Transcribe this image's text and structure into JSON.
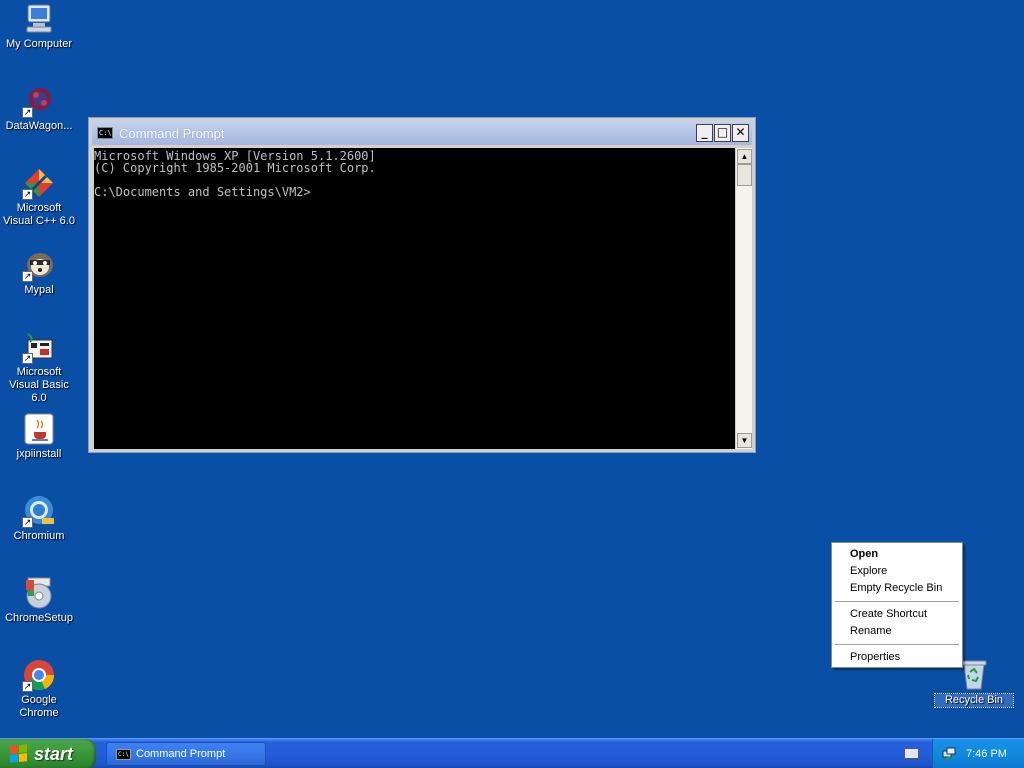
{
  "desktop": {
    "icons": [
      {
        "label": "My Computer",
        "icon": "my-computer-icon"
      },
      {
        "label": "DataWagon...",
        "icon": "datawagon-icon"
      },
      {
        "label": "Microsoft Visual C++ 6.0",
        "icon": "visual-cpp-icon"
      },
      {
        "label": "Mypal",
        "icon": "mypal-icon"
      },
      {
        "label": "Microsoft Visual Basic 6.0",
        "icon": "visual-basic-icon"
      },
      {
        "label": "jxpiinstall",
        "icon": "java-icon"
      },
      {
        "label": "Chromium",
        "icon": "chromium-icon"
      },
      {
        "label": "ChromeSetup",
        "icon": "chrome-setup-icon"
      },
      {
        "label": "Google Chrome",
        "icon": "google-chrome-icon"
      }
    ],
    "recycle_bin": {
      "label": "Recycle Bin",
      "icon": "recycle-bin-icon"
    }
  },
  "cmd_window": {
    "title": "Command Prompt",
    "icon": "C:\\",
    "minimize": "_",
    "maximize": "□",
    "close": "✕",
    "lines": [
      "Microsoft Windows XP [Version 5.1.2600]",
      "(C) Copyright 1985-2001 Microsoft Corp.",
      "",
      "C:\\Documents and Settings\\VM2>"
    ]
  },
  "context_menu": {
    "items": [
      {
        "label": "Open",
        "bold": true
      },
      {
        "label": "Explore"
      },
      {
        "label": "Empty Recycle Bin"
      },
      {
        "separator": true
      },
      {
        "label": "Create Shortcut"
      },
      {
        "label": "Rename"
      },
      {
        "separator": true
      },
      {
        "label": "Properties"
      }
    ]
  },
  "taskbar": {
    "start_label": "start",
    "tasks": [
      {
        "label": "Command Prompt",
        "icon": "C:\\"
      }
    ],
    "clock": "7:46 PM"
  },
  "colors": {
    "desktop_bg": "#0a4fa6",
    "taskbar_blue": "#245edb",
    "start_green": "#3d9b3d",
    "tray_blue": "#118be0"
  }
}
